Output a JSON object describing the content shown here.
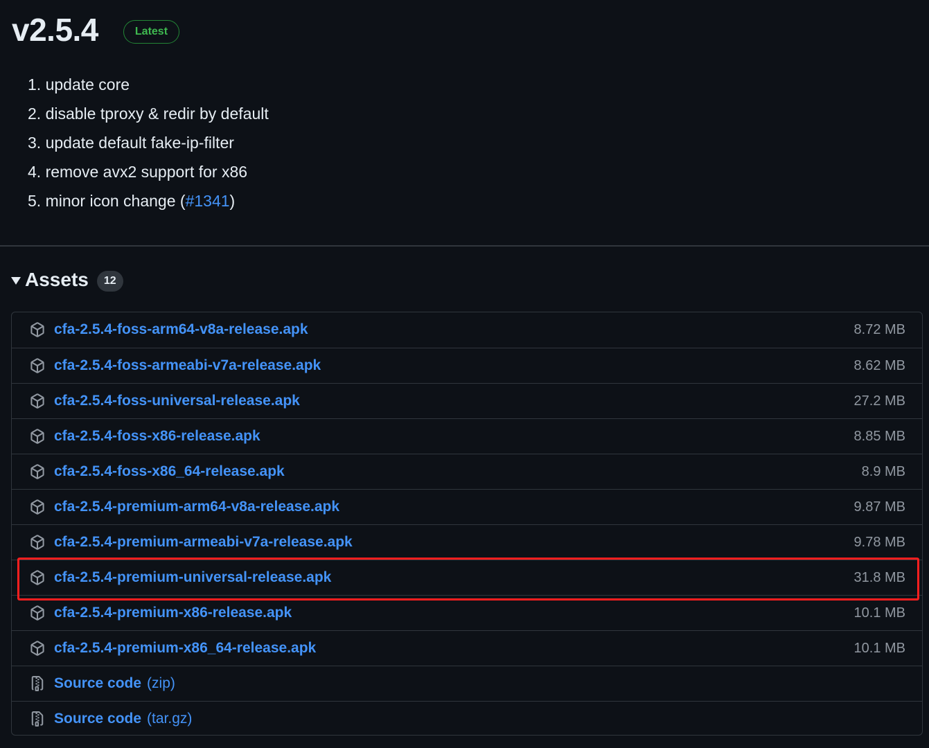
{
  "release": {
    "version": "v2.5.4",
    "badge": "Latest"
  },
  "notes": [
    {
      "text": "1. update core"
    },
    {
      "text": "2. disable tproxy & redir by default"
    },
    {
      "text": "3. update default fake-ip-filter"
    },
    {
      "text": "4. remove avx2 support for x86"
    },
    {
      "text": "5. minor icon change (",
      "link": "#1341",
      "suffix": ")"
    }
  ],
  "assets": {
    "title": "Assets",
    "count": "12",
    "files": [
      {
        "name": "cfa-2.5.4-foss-arm64-v8a-release.apk",
        "size": "8.72 MB"
      },
      {
        "name": "cfa-2.5.4-foss-armeabi-v7a-release.apk",
        "size": "8.62 MB"
      },
      {
        "name": "cfa-2.5.4-foss-universal-release.apk",
        "size": "27.2 MB"
      },
      {
        "name": "cfa-2.5.4-foss-x86-release.apk",
        "size": "8.85 MB"
      },
      {
        "name": "cfa-2.5.4-foss-x86_64-release.apk",
        "size": "8.9 MB"
      },
      {
        "name": "cfa-2.5.4-premium-arm64-v8a-release.apk",
        "size": "9.87 MB"
      },
      {
        "name": "cfa-2.5.4-premium-armeabi-v7a-release.apk",
        "size": "9.78 MB"
      },
      {
        "name": "cfa-2.5.4-premium-universal-release.apk",
        "size": "31.8 MB"
      },
      {
        "name": "cfa-2.5.4-premium-x86-release.apk",
        "size": "10.1 MB"
      },
      {
        "name": "cfa-2.5.4-premium-x86_64-release.apk",
        "size": "10.1 MB"
      }
    ],
    "sources": [
      {
        "label": "Source code",
        "ext": "(zip)"
      },
      {
        "label": "Source code",
        "ext": "(tar.gz)"
      }
    ]
  },
  "highlighted_asset": "cfa-2.5.4-premium-universal-release.apk",
  "colors": {
    "background": "#0d1117",
    "link": "#4493f8",
    "latest_badge": "#3fb950",
    "highlight": "#ff1f1f"
  }
}
